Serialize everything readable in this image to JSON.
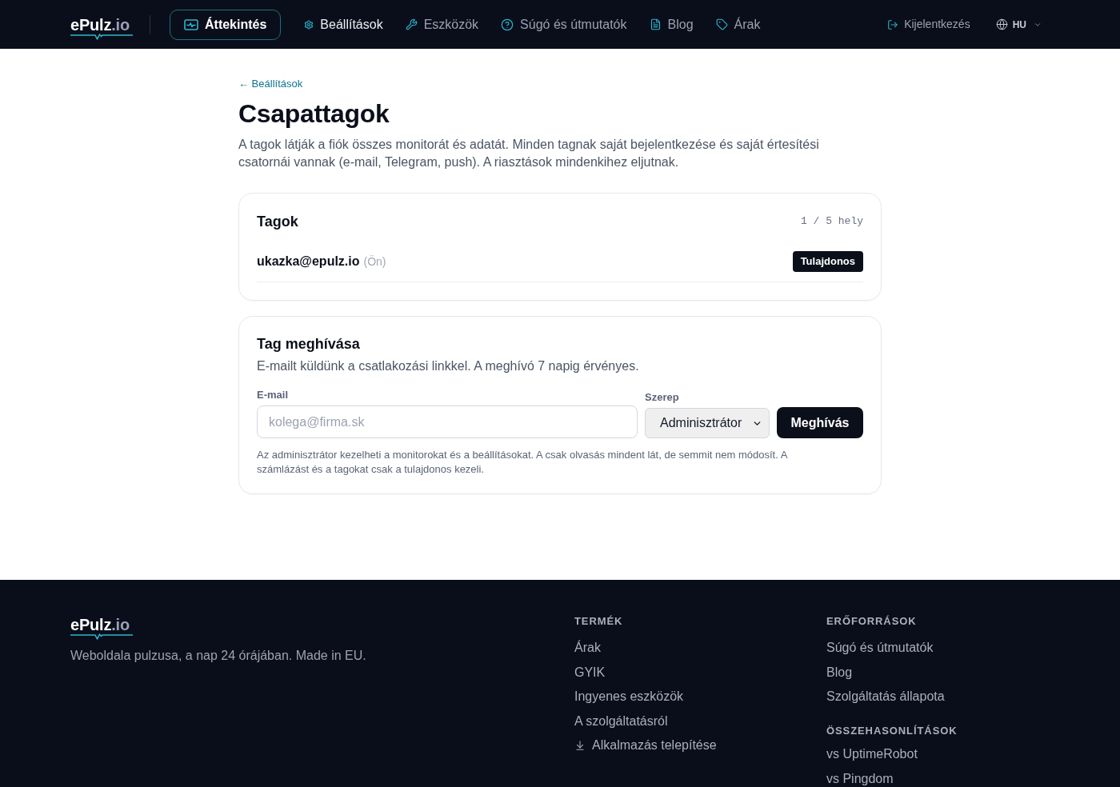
{
  "header": {
    "logo": {
      "name": "ePulz",
      "suffix": ".io"
    },
    "nav": [
      {
        "label": "Áttekintés",
        "selected": true,
        "current": false
      },
      {
        "label": "Beállítások",
        "selected": false,
        "current": true
      },
      {
        "label": "Eszközök",
        "selected": false,
        "current": false
      },
      {
        "label": "Súgó és útmutatók",
        "selected": false,
        "current": false
      },
      {
        "label": "Blog",
        "selected": false,
        "current": false
      },
      {
        "label": "Árak",
        "selected": false,
        "current": false
      }
    ],
    "logout": "Kijelentkezés",
    "language": "HU"
  },
  "page": {
    "back_link": "← Beállítások",
    "title": "Csapattagok",
    "description": "A tagok látják a fiók összes monitorát és adatát. Minden tagnak saját bejelentkezése és saját értesítési csatornái vannak (e-mail, Telegram, push). A riasztások mindenkihez eljutnak."
  },
  "members_card": {
    "title": "Tagok",
    "seats": "1 / 5 hely",
    "members": [
      {
        "email": "ukazka@epulz.io",
        "note": "(Ön)",
        "role": "Tulajdonos"
      }
    ]
  },
  "invite_card": {
    "title": "Tag meghívása",
    "description": "E-mailt küldünk a csatlakozási linkkel. A meghívó 7 napig érvényes.",
    "email_field": {
      "label": "E-mail",
      "placeholder": "kolega@firma.sk"
    },
    "role_field": {
      "label": "Szerep",
      "value": "Adminisztrátor"
    },
    "submit": "Meghívás",
    "help": "Az adminisztrátor kezelheti a monitorokat és a beállításokat. A csak olvasás mindent lát, de semmit nem módosít. A számlázást és a tagokat csak a tulajdonos kezeli."
  },
  "footer": {
    "logo": {
      "name": "ePulz",
      "suffix": ".io"
    },
    "tagline": "Weboldala pulzusa, a nap 24 órájában. Made in EU.",
    "columns": [
      {
        "sections": [
          {
            "heading": "TERMÉK",
            "links": [
              {
                "label": "Árak",
                "kind": "text"
              },
              {
                "label": "GYIK",
                "kind": "text"
              },
              {
                "label": "Ingyenes eszközök",
                "kind": "text"
              },
              {
                "label": "A szolgáltatásról",
                "kind": "text"
              },
              {
                "label": "Alkalmazás telepítése",
                "kind": "download"
              }
            ]
          }
        ]
      },
      {
        "sections": [
          {
            "heading": "ERŐFORRÁSOK",
            "links": [
              {
                "label": "Súgó és útmutatók",
                "kind": "text"
              },
              {
                "label": "Blog",
                "kind": "text"
              },
              {
                "label": "Szolgáltatás állapota",
                "kind": "text"
              }
            ]
          },
          {
            "heading": "ÖSSZEHASONLÍTÁSOK",
            "links": [
              {
                "label": "vs UptimeRobot",
                "kind": "text"
              },
              {
                "label": "vs Pingdom",
                "kind": "text"
              }
            ]
          }
        ]
      }
    ]
  }
}
